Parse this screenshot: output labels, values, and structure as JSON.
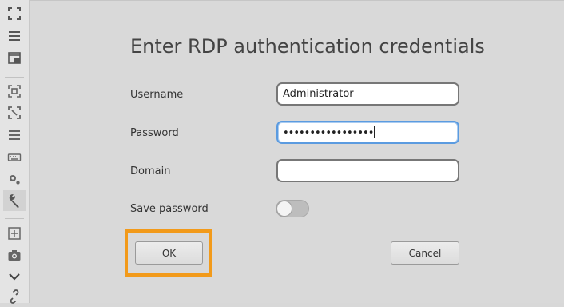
{
  "toolbar": {
    "icons": [
      "fullscreen-icon",
      "menu-icon",
      "window-icon",
      "fit-screen-icon",
      "scale-icon",
      "preferences-icon",
      "keyboard-icon",
      "settings-icon",
      "tools-icon",
      "new-tab-icon",
      "screenshot-icon",
      "chevron-down-icon",
      "disconnect-icon"
    ]
  },
  "dialog": {
    "title": "Enter RDP authentication credentials",
    "username_label": "Username",
    "username_value": "Administrator",
    "password_label": "Password",
    "password_value": "•••••••••••••••••",
    "domain_label": "Domain",
    "domain_value": "",
    "save_password_label": "Save password",
    "save_password_on": false,
    "ok_label": "OK",
    "cancel_label": "Cancel"
  },
  "colors": {
    "highlight": "#f29a1a",
    "focus": "#5b9be0"
  }
}
